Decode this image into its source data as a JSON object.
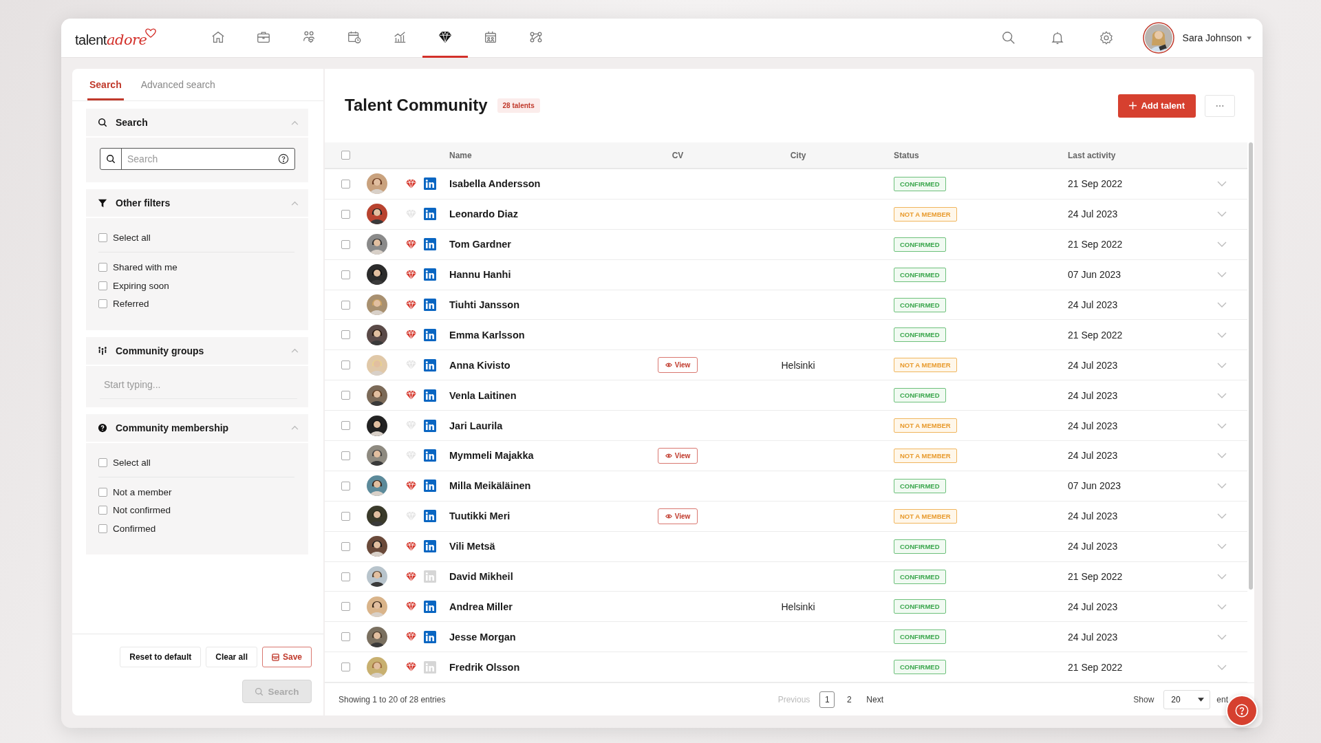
{
  "header": {
    "logo": {
      "plain": "talent",
      "script": "adore"
    },
    "nav_items": [
      {
        "selected": false
      },
      {
        "selected": false
      },
      {
        "selected": false
      },
      {
        "selected": false
      },
      {
        "selected": false
      },
      {
        "selected": true
      },
      {
        "selected": false
      },
      {
        "selected": false
      }
    ],
    "user": {
      "name": "Sara Johnson"
    }
  },
  "sidebar": {
    "tabs": [
      {
        "label": "Search",
        "selected": true
      },
      {
        "label": "Advanced search",
        "selected": false
      }
    ],
    "sections": [
      {
        "kind": "search",
        "title": "Search",
        "expanded": true,
        "placeholder": "Search"
      },
      {
        "kind": "checks",
        "title": "Other filters",
        "expanded": true,
        "select_all": {
          "label": "Select all",
          "checked": false
        },
        "options": [
          {
            "label": "Shared with me",
            "checked": false
          },
          {
            "label": "Expiring soon",
            "checked": false
          },
          {
            "label": "Referred",
            "checked": false
          }
        ]
      },
      {
        "kind": "groups",
        "title": "Community groups",
        "expanded": true,
        "placeholder": "Start typing..."
      },
      {
        "kind": "checks",
        "title": "Community membership",
        "expanded": true,
        "select_all": {
          "label": "Select all",
          "checked": false
        },
        "options": [
          {
            "label": "Not a member",
            "checked": false
          },
          {
            "label": "Not confirmed",
            "checked": false
          },
          {
            "label": "Confirmed",
            "checked": false
          }
        ]
      }
    ],
    "buttons": [
      {
        "label": "Reset to default",
        "kind": "plain"
      },
      {
        "label": "Clear all",
        "kind": "plain"
      },
      {
        "label": "Save",
        "kind": "save"
      }
    ],
    "search_button": {
      "label": "Search",
      "disabled": true
    }
  },
  "main": {
    "title": "Talent Community",
    "count_badge": "28 talents",
    "add_button": "Add talent",
    "table": {
      "all_checked": false,
      "columns": [
        "Name",
        "CV",
        "City",
        "Status",
        "Last activity"
      ],
      "rows": [
        {
          "name": "Isabella Andersson",
          "checked": false,
          "favorite": true,
          "linkedin": true,
          "cv": "",
          "city": "",
          "status": {
            "text": "CONFIRMED",
            "kind": "confirmed"
          },
          "last_activity": "21 Sep 2022"
        },
        {
          "name": "Leonardo Diaz",
          "checked": false,
          "favorite": false,
          "linkedin": true,
          "cv": "",
          "city": "",
          "status": {
            "text": "NOT A MEMBER",
            "kind": "not_member"
          },
          "last_activity": "24 Jul 2023"
        },
        {
          "name": "Tom Gardner",
          "checked": false,
          "favorite": true,
          "linkedin": true,
          "cv": "",
          "city": "",
          "status": {
            "text": "CONFIRMED",
            "kind": "confirmed"
          },
          "last_activity": "21 Sep 2022"
        },
        {
          "name": "Hannu Hanhi",
          "checked": false,
          "favorite": true,
          "linkedin": true,
          "cv": "",
          "city": "",
          "status": {
            "text": "CONFIRMED",
            "kind": "confirmed"
          },
          "last_activity": "07 Jun 2023"
        },
        {
          "name": "Tiuhti Jansson",
          "checked": false,
          "favorite": true,
          "linkedin": true,
          "cv": "",
          "city": "",
          "status": {
            "text": "CONFIRMED",
            "kind": "confirmed"
          },
          "last_activity": "24 Jul 2023"
        },
        {
          "name": "Emma Karlsson",
          "checked": false,
          "favorite": true,
          "linkedin": true,
          "cv": "",
          "city": "",
          "status": {
            "text": "CONFIRMED",
            "kind": "confirmed"
          },
          "last_activity": "21 Sep 2022"
        },
        {
          "name": "Anna Kivisto",
          "checked": false,
          "favorite": false,
          "linkedin": true,
          "cv": "View",
          "city": "Helsinki",
          "status": {
            "text": "NOT A MEMBER",
            "kind": "not_member"
          },
          "last_activity": "24 Jul 2023"
        },
        {
          "name": "Venla Laitinen",
          "checked": false,
          "favorite": true,
          "linkedin": true,
          "cv": "",
          "city": "",
          "status": {
            "text": "CONFIRMED",
            "kind": "confirmed"
          },
          "last_activity": "24 Jul 2023"
        },
        {
          "name": "Jari Laurila",
          "checked": false,
          "favorite": false,
          "linkedin": true,
          "cv": "",
          "city": "",
          "status": {
            "text": "NOT A MEMBER",
            "kind": "not_member"
          },
          "last_activity": "24 Jul 2023"
        },
        {
          "name": "Mymmeli Majakka",
          "checked": false,
          "favorite": false,
          "linkedin": true,
          "cv": "View",
          "city": "",
          "status": {
            "text": "NOT A MEMBER",
            "kind": "not_member"
          },
          "last_activity": "24 Jul 2023"
        },
        {
          "name": "Milla Meikäläinen",
          "checked": false,
          "favorite": true,
          "linkedin": true,
          "cv": "",
          "city": "",
          "status": {
            "text": "CONFIRMED",
            "kind": "confirmed"
          },
          "last_activity": "07 Jun 2023"
        },
        {
          "name": "Tuutikki Meri",
          "checked": false,
          "favorite": false,
          "linkedin": true,
          "cv": "View",
          "city": "",
          "status": {
            "text": "NOT A MEMBER",
            "kind": "not_member"
          },
          "last_activity": "24 Jul 2023"
        },
        {
          "name": "Vili Metsä",
          "checked": false,
          "favorite": true,
          "linkedin": true,
          "cv": "",
          "city": "",
          "status": {
            "text": "CONFIRMED",
            "kind": "confirmed"
          },
          "last_activity": "24 Jul 2023"
        },
        {
          "name": "David Mikheil",
          "checked": false,
          "favorite": true,
          "linkedin": false,
          "cv": "",
          "city": "",
          "status": {
            "text": "CONFIRMED",
            "kind": "confirmed"
          },
          "last_activity": "21 Sep 2022"
        },
        {
          "name": "Andrea Miller",
          "checked": false,
          "favorite": true,
          "linkedin": true,
          "cv": "",
          "city": "Helsinki",
          "status": {
            "text": "CONFIRMED",
            "kind": "confirmed"
          },
          "last_activity": "24 Jul 2023"
        },
        {
          "name": "Jesse Morgan",
          "checked": false,
          "favorite": true,
          "linkedin": true,
          "cv": "",
          "city": "",
          "status": {
            "text": "CONFIRMED",
            "kind": "confirmed"
          },
          "last_activity": "24 Jul 2023"
        },
        {
          "name": "Fredrik Olsson",
          "checked": false,
          "favorite": true,
          "linkedin": false,
          "cv": "",
          "city": "",
          "status": {
            "text": "CONFIRMED",
            "kind": "confirmed"
          },
          "last_activity": "21 Sep 2022"
        }
      ]
    },
    "footer": {
      "summary": "Showing 1 to 20 of 28 entries",
      "previous": {
        "label": "Previous",
        "disabled": true
      },
      "pages": [
        {
          "label": "1",
          "selected": true
        },
        {
          "label": "2",
          "selected": false
        }
      ],
      "next": {
        "label": "Next",
        "disabled": false
      },
      "show_label": "Show",
      "page_size": "20",
      "entries_label": "ent"
    }
  }
}
